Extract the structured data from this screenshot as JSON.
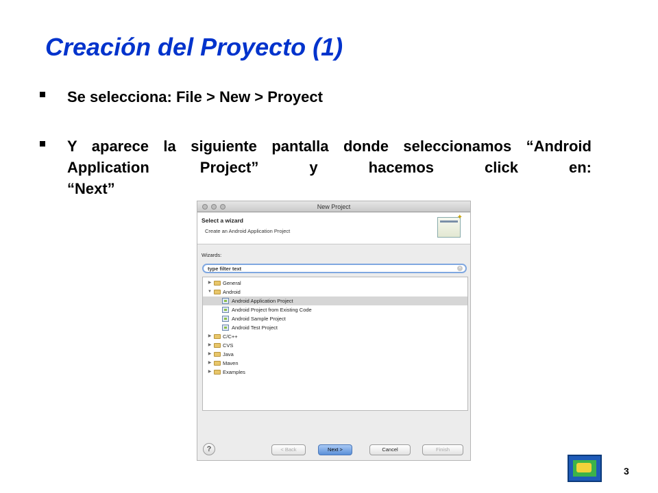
{
  "slide": {
    "title": "Creación del Proyecto (1)",
    "bullets": [
      "Se selecciona: File > New > Proyect",
      "Y aparece la siguiente pantalla donde seleccionamos “Android Application Project” y hacemos click en:",
      "“Next”"
    ],
    "page_number": "3",
    "title_color": "#0033cc"
  },
  "dialog": {
    "title": "New Project",
    "header_title": "Select a wizard",
    "header_subtitle": "Create an Android Application Project",
    "wizards_label": "Wizards:",
    "filter_value": "type filter text",
    "tree": [
      {
        "label": "General",
        "expanded": false,
        "icon": "folder-icon"
      },
      {
        "label": "Android",
        "expanded": true,
        "icon": "folder-icon"
      },
      {
        "label": "Android Application Project",
        "icon": "android-project-icon",
        "selected": true
      },
      {
        "label": "Android Project from Existing Code",
        "icon": "android-project-icon"
      },
      {
        "label": "Android Sample Project",
        "icon": "android-project-icon"
      },
      {
        "label": "Android Test Project",
        "icon": "android-test-icon"
      },
      {
        "label": "C/C++",
        "expanded": false,
        "icon": "folder-icon"
      },
      {
        "label": "CVS",
        "expanded": false,
        "icon": "folder-icon"
      },
      {
        "label": "Java",
        "expanded": false,
        "icon": "folder-icon"
      },
      {
        "label": "Maven",
        "expanded": false,
        "icon": "folder-icon"
      },
      {
        "label": "Examples",
        "expanded": false,
        "icon": "folder-icon"
      }
    ],
    "buttons": {
      "help": "?",
      "back": "< Back",
      "next": "Next >",
      "cancel": "Cancel",
      "finish": "Finish"
    }
  }
}
